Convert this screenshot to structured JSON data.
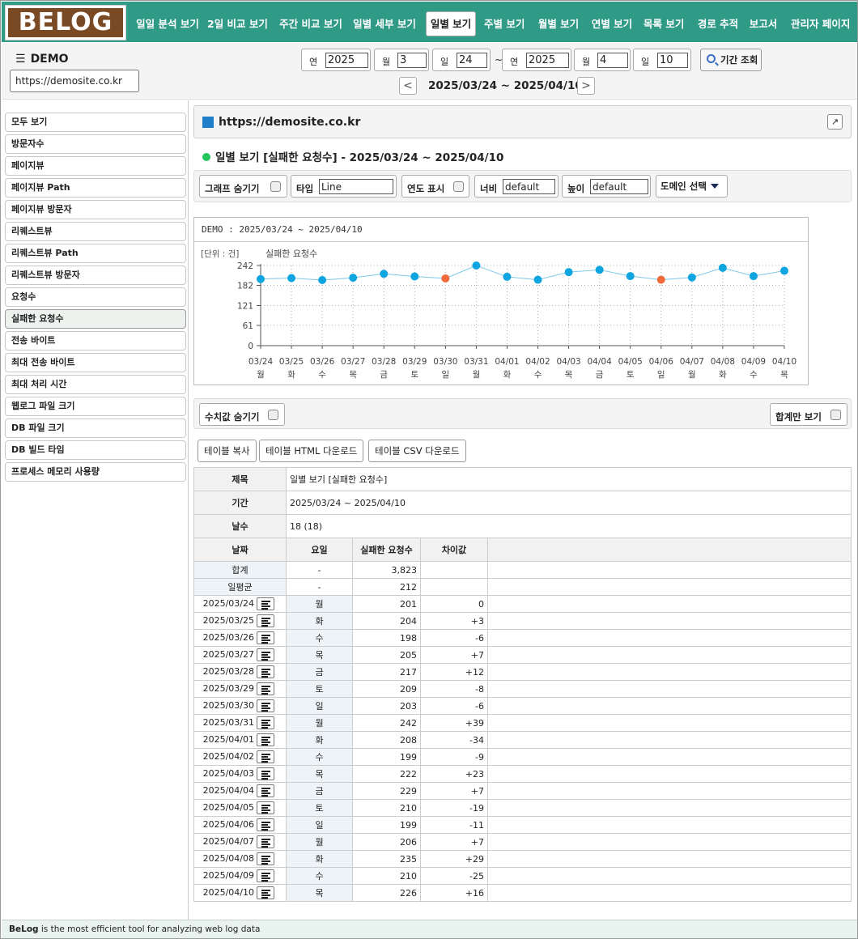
{
  "logo": "BELOG",
  "nav": [
    "일일 분석 보기",
    "2일 비교 보기",
    "주간 비교 보기",
    "일별 세부 보기",
    "일별 보기",
    "주별 보기",
    "월별 보기",
    "연별 보기",
    "목록 보기",
    "경로 추적",
    "보고서",
    "관리자 페이지"
  ],
  "nav_active_index": 4,
  "site": {
    "name": "DEMO",
    "url": "https://demosite.co.kr"
  },
  "date_picker": {
    "start": {
      "year_label": "연",
      "year": "2025",
      "month_label": "월",
      "month": "3",
      "day_label": "일",
      "day": "24"
    },
    "separator": "~",
    "end": {
      "year_label": "연",
      "year": "2025",
      "month_label": "월",
      "month": "4",
      "day_label": "일",
      "day": "10"
    },
    "query_button": "기간 조회",
    "prev": "<",
    "next": ">",
    "range": "2025/03/24 ~ 2025/04/10"
  },
  "sidebar": [
    "모두 보기",
    "방문자수",
    "페이지뷰",
    "페이지뷰 Path",
    "페이지뷰 방문자",
    "리퀘스트뷰",
    "리퀘스트뷰 Path",
    "리퀘스트뷰 방문자",
    "요청수",
    "실패한 요청수",
    "전송 바이트",
    "최대 전송 바이트",
    "최대 처리 시간",
    "웹로그 파일 크기",
    "DB 파일 크기",
    "DB 빌드 타임",
    "프로세스 메모리 사용량"
  ],
  "sidebar_active_index": 9,
  "main": {
    "site_url": "https://demosite.co.kr",
    "popout": "↗",
    "heading": "일별 보기 [실패한 요청수] - 2025/03/24 ~ 2025/04/10"
  },
  "graph_options": {
    "hide_graph": "그래프 숨기기",
    "type_label": "타입",
    "type_value": "Line",
    "show_year": "연도 표시",
    "width_label": "너비",
    "width_value": "default",
    "height_label": "높이",
    "height_value": "default",
    "domain_select": "도메인 선택"
  },
  "chart_title": "DEMO : 2025/03/24 ~ 2025/04/10",
  "colors": {
    "line": "#7ec8e8",
    "point": "#0ea5e0",
    "weekend_point": "#f06a3a",
    "header": "#2f9a86"
  },
  "chart_data": {
    "type": "line",
    "unit_label": "[단위 : 건]",
    "series": [
      {
        "name": "실패한 요청수",
        "values": [
          201,
          204,
          198,
          205,
          217,
          209,
          203,
          242,
          208,
          199,
          222,
          229,
          210,
          199,
          206,
          235,
          210,
          226
        ]
      }
    ],
    "categories": [
      "03/24",
      "03/25",
      "03/26",
      "03/27",
      "03/28",
      "03/29",
      "03/30",
      "03/31",
      "04/01",
      "04/02",
      "04/03",
      "04/04",
      "04/05",
      "04/06",
      "04/07",
      "04/08",
      "04/09",
      "04/10"
    ],
    "dow": [
      "월",
      "화",
      "수",
      "목",
      "금",
      "토",
      "일",
      "월",
      "화",
      "수",
      "목",
      "금",
      "토",
      "일",
      "월",
      "화",
      "수",
      "목"
    ],
    "highlight_indices": [
      6,
      13
    ],
    "yticks": [
      0,
      61,
      121,
      182,
      242
    ],
    "ylim": [
      0,
      242
    ],
    "grid": true
  },
  "table_options": {
    "hide_values": "수치값 숨기기",
    "total_only": "합계만 보기"
  },
  "table_buttons": [
    "테이블 복사",
    "테이블 HTML 다운로드",
    "테이블 CSV 다운로드"
  ],
  "table": {
    "meta": [
      {
        "label": "제목",
        "value": "일별 보기 [실패한 요청수]"
      },
      {
        "label": "기간",
        "value": "2025/03/24 ~ 2025/04/10"
      },
      {
        "label": "날수",
        "value": "18 (18)"
      }
    ],
    "headers": [
      "날짜",
      "요일",
      "실패한 요청수",
      "차이값"
    ],
    "summary": [
      {
        "label": "합계",
        "dow": "-",
        "value": "3,823",
        "diff": ""
      },
      {
        "label": "일평균",
        "dow": "-",
        "value": "212",
        "diff": ""
      }
    ],
    "rows": [
      {
        "date": "2025/03/24",
        "dow": "월",
        "value": "201",
        "diff": "0"
      },
      {
        "date": "2025/03/25",
        "dow": "화",
        "value": "204",
        "diff": "+3"
      },
      {
        "date": "2025/03/26",
        "dow": "수",
        "value": "198",
        "diff": "-6"
      },
      {
        "date": "2025/03/27",
        "dow": "목",
        "value": "205",
        "diff": "+7"
      },
      {
        "date": "2025/03/28",
        "dow": "금",
        "value": "217",
        "diff": "+12"
      },
      {
        "date": "2025/03/29",
        "dow": "토",
        "value": "209",
        "diff": "-8"
      },
      {
        "date": "2025/03/30",
        "dow": "일",
        "value": "203",
        "diff": "-6"
      },
      {
        "date": "2025/03/31",
        "dow": "월",
        "value": "242",
        "diff": "+39"
      },
      {
        "date": "2025/04/01",
        "dow": "화",
        "value": "208",
        "diff": "-34"
      },
      {
        "date": "2025/04/02",
        "dow": "수",
        "value": "199",
        "diff": "-9"
      },
      {
        "date": "2025/04/03",
        "dow": "목",
        "value": "222",
        "diff": "+23"
      },
      {
        "date": "2025/04/04",
        "dow": "금",
        "value": "229",
        "diff": "+7"
      },
      {
        "date": "2025/04/05",
        "dow": "토",
        "value": "210",
        "diff": "-19"
      },
      {
        "date": "2025/04/06",
        "dow": "일",
        "value": "199",
        "diff": "-11"
      },
      {
        "date": "2025/04/07",
        "dow": "월",
        "value": "206",
        "diff": "+7"
      },
      {
        "date": "2025/04/08",
        "dow": "화",
        "value": "235",
        "diff": "+29"
      },
      {
        "date": "2025/04/09",
        "dow": "수",
        "value": "210",
        "diff": "-25"
      },
      {
        "date": "2025/04/10",
        "dow": "목",
        "value": "226",
        "diff": "+16"
      }
    ]
  },
  "footer": {
    "brand": "BeLog",
    "text": " is the most efficient tool for analyzing web log data"
  }
}
